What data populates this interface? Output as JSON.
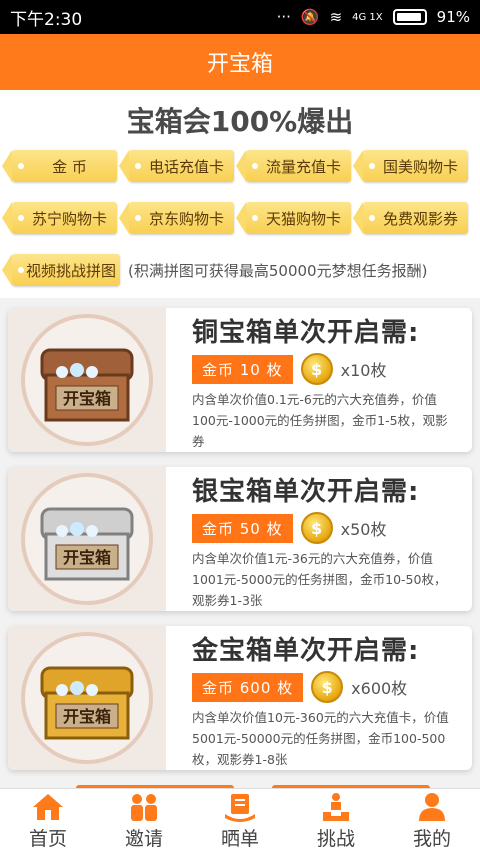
{
  "status_bar": {
    "time": "下午2:30",
    "network": "4G 1X",
    "battery": "91%"
  },
  "header": {
    "title": "开宝箱"
  },
  "hero": {
    "title": "宝箱会100%爆出",
    "tags": [
      "金 币",
      "电话充值卡",
      "流量充值卡",
      "国美购物卡",
      "苏宁购物卡",
      "京东购物卡",
      "天猫购物卡",
      "免费观影券"
    ],
    "challenge_tag": "视频挑战拼图",
    "challenge_note": "(积满拼图可获得最高50000元梦想任务报酬)"
  },
  "chests": [
    {
      "chest_label": "开宝箱",
      "title": "铜宝箱单次开启需:",
      "price": "金币  10  枚",
      "multiplier": "x10枚",
      "desc": "内含单次价值0.1元-6元的六大充值券，价值100元-1000元的任务拼图，金币1-5枚，观影券",
      "color": "#a0603a"
    },
    {
      "chest_label": "开宝箱",
      "title": "银宝箱单次开启需:",
      "price": "金币  50  枚",
      "multiplier": "x50枚",
      "desc": "内含单次价值1元-36元的六大充值券，价值1001元-5000元的任务拼图，金币10-50枚，观影券1-3张",
      "color": "#bdbdbd"
    },
    {
      "chest_label": "开宝箱",
      "title": "金宝箱单次开启需:",
      "price": "金币  600  枚",
      "multiplier": "x600枚",
      "desc": "内含单次价值10元-360元的六大充值卡，价值5001元-50000元的任务拼图，金币100-500枚，观影券1-8张",
      "color": "#e0a42a"
    }
  ],
  "nav": [
    {
      "label": "首页",
      "icon": "home-icon"
    },
    {
      "label": "邀请",
      "icon": "invite-icon"
    },
    {
      "label": "晒单",
      "icon": "share-order-icon"
    },
    {
      "label": "挑战",
      "icon": "challenge-icon"
    },
    {
      "label": "我的",
      "icon": "profile-icon"
    }
  ],
  "colors": {
    "accent": "#ff7a1a",
    "tag": "#f8cf52"
  }
}
